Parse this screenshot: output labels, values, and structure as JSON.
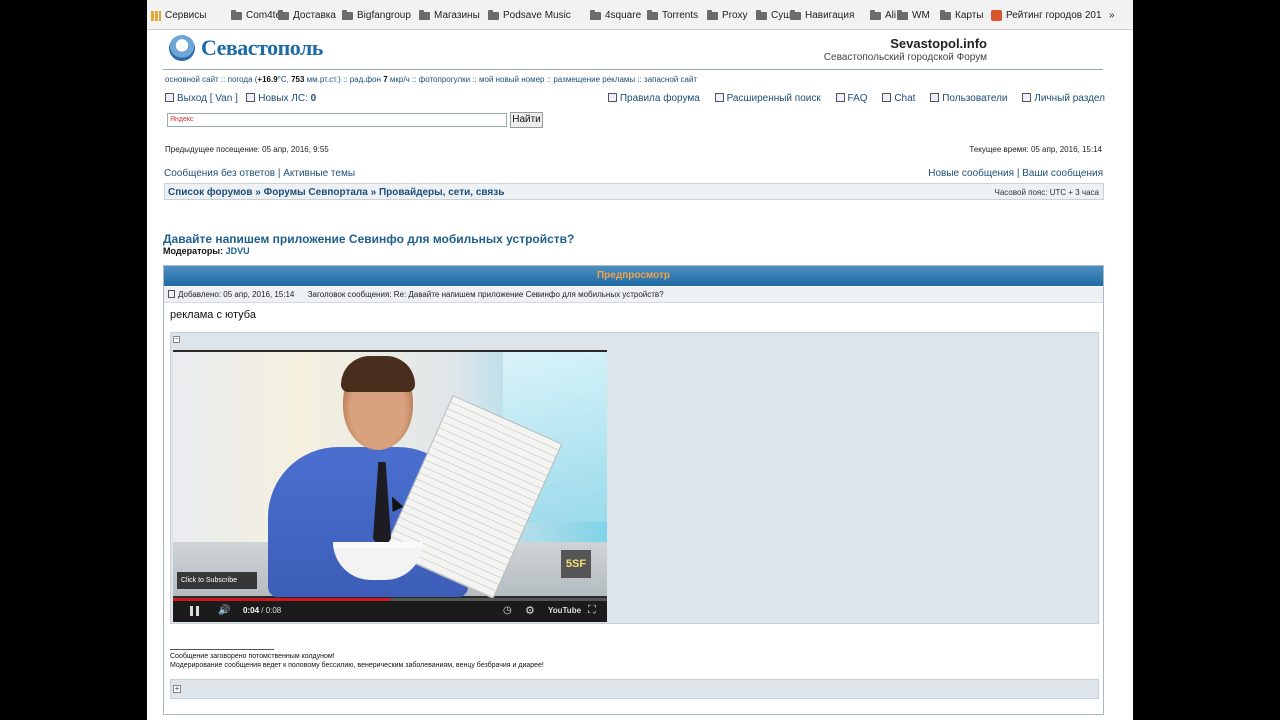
{
  "bookmarks": [
    {
      "icon": "apps-icon",
      "label": "Сервисы"
    },
    {
      "icon": "folder-icon",
      "label": "Com4tel"
    },
    {
      "icon": "folder-icon",
      "label": "Доставка"
    },
    {
      "icon": "folder-icon",
      "label": "Bigfangroup"
    },
    {
      "icon": "folder-icon",
      "label": "Магазины"
    },
    {
      "icon": "folder-icon",
      "label": "Podsave Music"
    },
    {
      "icon": "folder-icon",
      "label": "4square"
    },
    {
      "icon": "folder-icon",
      "label": "Torrents"
    },
    {
      "icon": "folder-icon",
      "label": "Proxy"
    },
    {
      "icon": "folder-icon",
      "label": "Суши"
    },
    {
      "icon": "folder-icon",
      "label": "Навигация"
    },
    {
      "icon": "folder-icon",
      "label": "Ali"
    },
    {
      "icon": "folder-icon",
      "label": "WM"
    },
    {
      "icon": "folder-icon",
      "label": "Карты"
    },
    {
      "icon": "favicon",
      "label": "Рейтинг городов 201"
    }
  ],
  "header": {
    "logo_text": "Севастополь",
    "site_title": "Sevastopol.info",
    "site_subtitle": "Севастопольский городской Форум"
  },
  "topnav": {
    "main_site": "основной сайт",
    "weather_prefix": "погода (",
    "temp": "+16.9",
    "temp_unit": "°C, ",
    "pressure": "753",
    "pressure_unit": " мм.рт.ст.)",
    "radiation_prefix": "рад.фон ",
    "radiation": "7",
    "radiation_unit": " мкр/ч",
    "photo_walks": "фотопрогулки",
    "new_number": "мой новый номер",
    "ads": "размещение рекламы",
    "backup_site": "запасной сайт",
    "sep": " :: "
  },
  "userbar": {
    "logout": "Выход [ Van ]",
    "new_pm_label": "Новых ЛС: ",
    "new_pm_count": "0",
    "rules": "Правила форума",
    "advanced_search": "Расширенный поиск",
    "faq": "FAQ",
    "chat": "Chat",
    "users": "Пользователи",
    "personal": "Личный раздел"
  },
  "search": {
    "placeholder": "Яндекс",
    "button": "Найти"
  },
  "visits": {
    "previous": "Предыдущее посещение: 05 апр, 2016, 9:55",
    "current": "Текущее время: 05 апр, 2016, 15:14"
  },
  "quicklinks": {
    "unanswered": "Сообщения без ответов",
    "active": "Активные темы",
    "new_posts": "Новые сообщения",
    "your_posts": "Ваши сообщения",
    "sep": " | "
  },
  "breadcrumbs": {
    "items": [
      "Список форумов",
      "Форумы Севпортала",
      "Провайдеры, сети, связь"
    ],
    "sep": " » ",
    "timezone": "Часовой пояс: UTC + 3 часа"
  },
  "topic": {
    "title": "Давайте напишем приложение Севинфо для мобильных устройств?",
    "moderators_label": "Модераторы: ",
    "moderator": "JDVU"
  },
  "preview": {
    "header": "Предпросмотр",
    "added": "Добавлено: 05 апр, 2016, 15:14",
    "subject": "Заголовок сообщения: Re: Давайте напишем приложение Севинфо для мобильных устройств?",
    "body": "реклама с ютуба",
    "signature_line1": "Сообщение заговорено потомственным колдуном!",
    "signature_line2": "Модерирование сообщения ведет к половому бессилию, венерическим заболеваниям, венцу безбрачия и диарее!",
    "collapse_symbol": "−",
    "expand_symbol": "+"
  },
  "video": {
    "subscribe": "Click to Subscribe",
    "brand_badge": "5SF",
    "current_time": "0:04",
    "duration": " / 0:08",
    "progress": 0.5,
    "platform": "YouTube"
  },
  "colors": {
    "link": "#1e4e79",
    "header_gradient": "#1f6aa3",
    "header_text": "#f0a34a",
    "panel_bg": "#dde5eb",
    "progress": "#cc181e"
  }
}
